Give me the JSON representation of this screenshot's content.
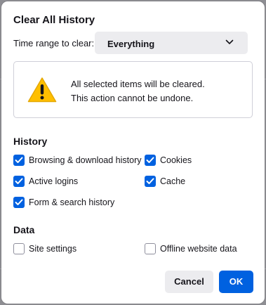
{
  "dialog": {
    "title": "Clear All History",
    "time_range": {
      "label": "Time range to clear:",
      "selected": "Everything"
    },
    "warning": {
      "line1": "All selected items will be cleared.",
      "line2": "This action cannot be undone."
    },
    "history": {
      "heading": "History",
      "options": [
        {
          "label": "Browsing & download history",
          "checked": true
        },
        {
          "label": "Cookies",
          "checked": true
        },
        {
          "label": "Active logins",
          "checked": true
        },
        {
          "label": "Cache",
          "checked": true
        },
        {
          "label": "Form & search history",
          "checked": true
        }
      ]
    },
    "data": {
      "heading": "Data",
      "options": [
        {
          "label": "Site settings",
          "checked": false
        },
        {
          "label": "Offline website data",
          "checked": false
        }
      ]
    },
    "buttons": {
      "cancel": "Cancel",
      "ok": "OK"
    }
  },
  "colors": {
    "accent": "#0061e0",
    "warning_fill": "#ffbf00",
    "button_gray": "#ececef"
  },
  "icons": {
    "dropdown": "chevron-down-icon",
    "warning": "warning-icon",
    "checkbox_checked": "checkmark-icon"
  }
}
